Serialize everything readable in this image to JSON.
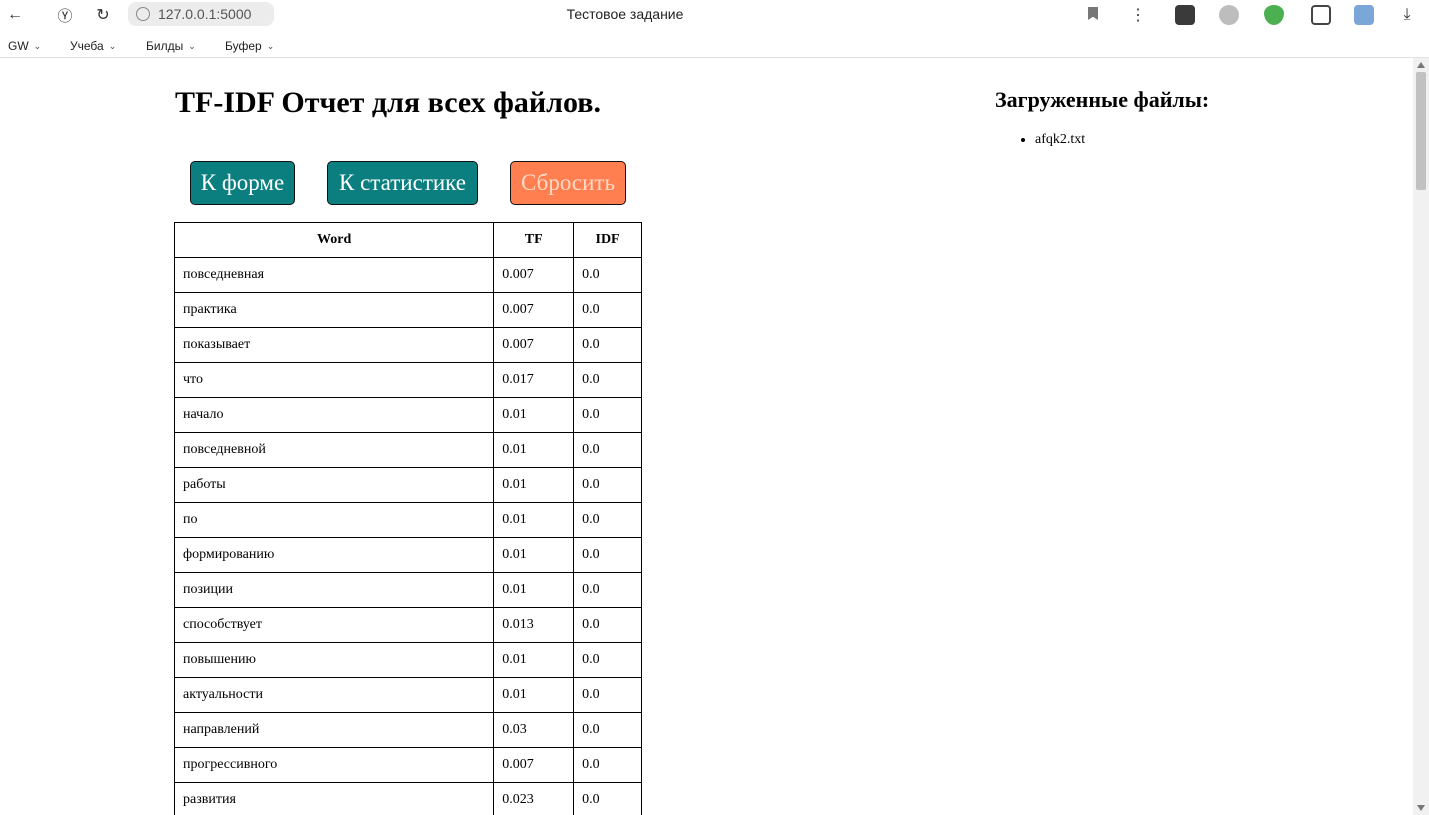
{
  "browser": {
    "url": "127.0.0.1:5000",
    "tab_title": "Тестовое задание"
  },
  "bookmarks": [
    {
      "label": "GW"
    },
    {
      "label": "Учеба"
    },
    {
      "label": "Билды"
    },
    {
      "label": "Буфер"
    }
  ],
  "page": {
    "title": "TF-IDF Отчет для всех файлов.",
    "buttons": {
      "form": "К форме",
      "stats": "К статистике",
      "reset": "Сбросить"
    },
    "table": {
      "headers": {
        "word": "Word",
        "tf": "TF",
        "idf": "IDF"
      },
      "rows": [
        {
          "word": "повседневная",
          "tf": "0.007",
          "idf": "0.0"
        },
        {
          "word": "практика",
          "tf": "0.007",
          "idf": "0.0"
        },
        {
          "word": "показывает",
          "tf": "0.007",
          "idf": "0.0"
        },
        {
          "word": "что",
          "tf": "0.017",
          "idf": "0.0"
        },
        {
          "word": "начало",
          "tf": "0.01",
          "idf": "0.0"
        },
        {
          "word": "повседневной",
          "tf": "0.01",
          "idf": "0.0"
        },
        {
          "word": "работы",
          "tf": "0.01",
          "idf": "0.0"
        },
        {
          "word": "по",
          "tf": "0.01",
          "idf": "0.0"
        },
        {
          "word": "формированию",
          "tf": "0.01",
          "idf": "0.0"
        },
        {
          "word": "позиции",
          "tf": "0.01",
          "idf": "0.0"
        },
        {
          "word": "способствует",
          "tf": "0.013",
          "idf": "0.0"
        },
        {
          "word": "повышению",
          "tf": "0.01",
          "idf": "0.0"
        },
        {
          "word": "актуальности",
          "tf": "0.01",
          "idf": "0.0"
        },
        {
          "word": "направлений",
          "tf": "0.03",
          "idf": "0.0"
        },
        {
          "word": "прогрессивного",
          "tf": "0.007",
          "idf": "0.0"
        },
        {
          "word": "развития",
          "tf": "0.023",
          "idf": "0.0"
        }
      ]
    },
    "sidebar": {
      "title": "Загруженные файлы:",
      "files": [
        "afqk2.txt"
      ]
    }
  },
  "colors": {
    "teal": "#0b7f7f",
    "coral": "#ff7f50"
  }
}
